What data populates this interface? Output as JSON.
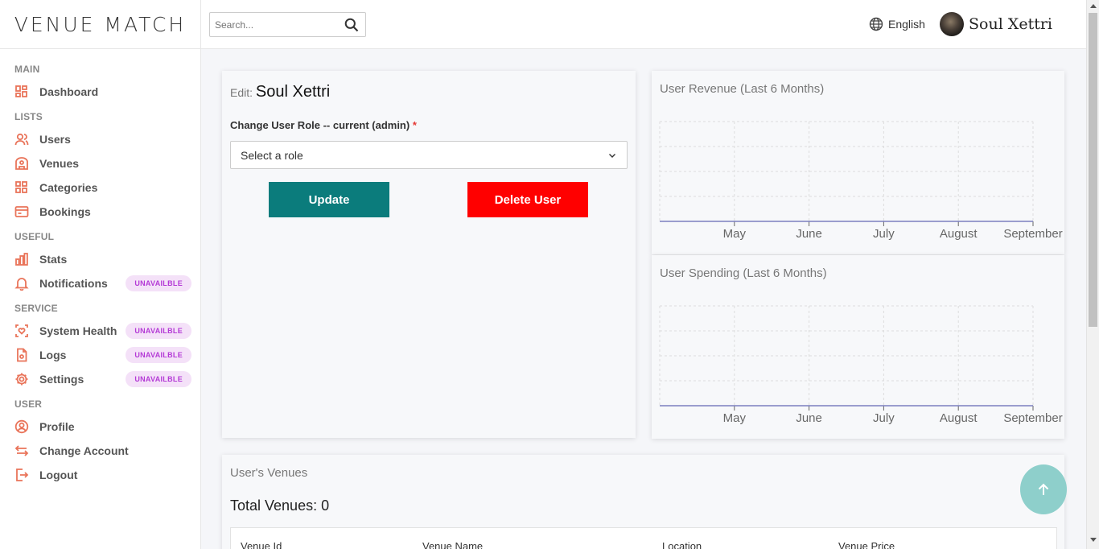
{
  "brand": {
    "logo": "VENUE MATCH"
  },
  "sidebar": {
    "sections": {
      "main": "MAIN",
      "lists": "LISTS",
      "useful": "USEFUL",
      "service": "SERVICE",
      "user": "USER"
    },
    "items": {
      "dashboard": "Dashboard",
      "users": "Users",
      "venues": "Venues",
      "categories": "Categories",
      "bookings": "Bookings",
      "stats": "Stats",
      "notifications": "Notifications",
      "system_health": "System Health",
      "logs": "Logs",
      "settings": "Settings",
      "profile": "Profile",
      "change_account": "Change Account",
      "logout": "Logout"
    },
    "badge_text": "UNAVAILBLE"
  },
  "topbar": {
    "search_placeholder": "Search...",
    "language": "English",
    "user_name": "Soul Xettri"
  },
  "edit": {
    "prefix": "Edit: ",
    "name": "Soul Xettri",
    "role_label": "Change User Role -- current (admin)",
    "required_mark": "*",
    "select_value": "Select a role",
    "update_label": "Update",
    "delete_label": "Delete User"
  },
  "charts": {
    "revenue_title": "User Revenue (Last 6 Months)",
    "spending_title": "User Spending (Last 6 Months)"
  },
  "chart_data": [
    {
      "type": "line",
      "title": "User Revenue (Last 6 Months)",
      "categories": [
        "",
        "May",
        "June",
        "July",
        "August",
        "September"
      ],
      "series": [
        {
          "values": [
            0,
            0,
            0,
            0,
            0,
            0
          ]
        }
      ],
      "grid": true
    },
    {
      "type": "line",
      "title": "User Spending (Last 6 Months)",
      "categories": [
        "",
        "May",
        "June",
        "July",
        "August",
        "September"
      ],
      "series": [
        {
          "values": [
            0,
            0,
            0,
            0,
            0,
            0
          ]
        }
      ],
      "grid": true
    }
  ],
  "venues": {
    "title": "User's Venues",
    "total": "Total Venues: 0",
    "columns": [
      "Venue Id",
      "Venue Name",
      "Location",
      "Venue Price"
    ]
  },
  "colors": {
    "accent_icon": "#e9745a",
    "update_button": "#0b7c7c",
    "delete_button": "#ff0000",
    "badge_text": "#b43ad6",
    "badge_bg": "#f4e1f8",
    "fab": "#8ecfcb",
    "chart_line": "#7b7fc0"
  }
}
